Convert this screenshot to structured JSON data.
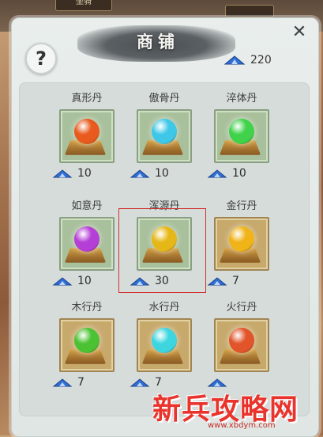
{
  "header": {
    "top_badge": "坐骑",
    "top_badge_right": "",
    "title": "商铺",
    "help_label": "?",
    "close_label": "✕"
  },
  "currency": {
    "icon": "spirit-stone-icon",
    "amount": "220"
  },
  "items": [
    {
      "name": "真形丹",
      "price": "10",
      "orb_color": "#e85a1e",
      "frame": "green"
    },
    {
      "name": "傲骨丹",
      "price": "10",
      "orb_color": "#3fc7e8",
      "frame": "green"
    },
    {
      "name": "淬体丹",
      "price": "10",
      "orb_color": "#3fd24a",
      "frame": "green"
    },
    {
      "name": "如意丹",
      "price": "10",
      "orb_color": "#b53fd6",
      "frame": "green"
    },
    {
      "name": "浑源丹",
      "price": "30",
      "orb_color": "#e6b817",
      "frame": "green"
    },
    {
      "name": "金行丹",
      "price": "7",
      "orb_color": "#f0b318",
      "frame": "gold"
    },
    {
      "name": "木行丹",
      "price": "7",
      "orb_color": "#4bc233",
      "frame": "gold"
    },
    {
      "name": "水行丹",
      "price": "7",
      "orb_color": "#3dd6e0",
      "frame": "gold"
    },
    {
      "name": "火行丹",
      "price": "",
      "orb_color": "#e2542a",
      "frame": "gold"
    }
  ],
  "watermark": {
    "text": "新兵攻略网",
    "url": "www.xbdym.com"
  }
}
